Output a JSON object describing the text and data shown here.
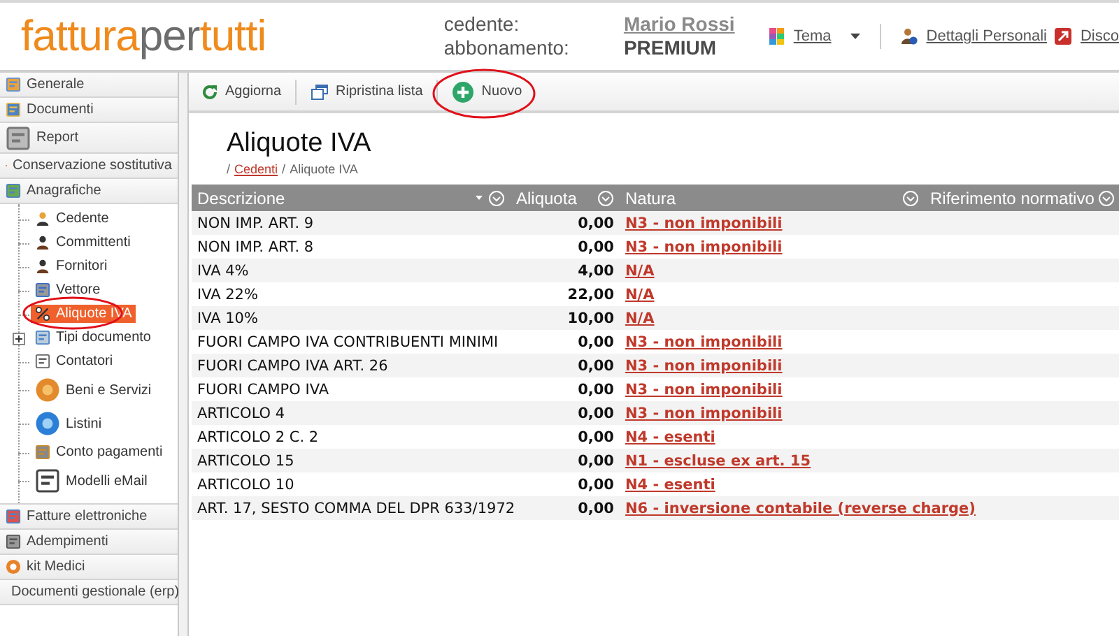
{
  "header": {
    "logo": [
      {
        "text": "fattura",
        "kind": "accent"
      },
      {
        "text": "per",
        "kind": "plain"
      },
      {
        "text": "tutti",
        "kind": "accent"
      }
    ],
    "account": [
      {
        "label": "cedente:",
        "value": "Mario Rossi",
        "kind": "link"
      },
      {
        "label": "abbonamento:",
        "value": "PREMIUM",
        "kind": "plain"
      }
    ],
    "links": [
      {
        "label": "Tema",
        "kind": "theme"
      },
      {
        "label": "Dettagli Personali",
        "kind": "user"
      },
      {
        "label": "Disco",
        "kind": "logout"
      }
    ]
  },
  "sidebar": {
    "sections_before": [
      {
        "label": "Generale"
      },
      {
        "label": "Documenti"
      },
      {
        "label": "Report"
      },
      {
        "label": "Conservazione sostitutiva"
      }
    ],
    "open_section": {
      "label": "Anagrafiche",
      "items": [
        {
          "label": "Cedente",
          "selected": false,
          "circled": false
        },
        {
          "label": "Committenti",
          "selected": false,
          "circled": false
        },
        {
          "label": "Fornitori",
          "selected": false,
          "circled": false
        },
        {
          "label": "Vettore",
          "selected": false,
          "circled": false
        },
        {
          "label": "Aliquote IVA",
          "selected": true,
          "circled": true
        },
        {
          "label": "Tipi documento",
          "selected": false,
          "circled": false,
          "expanded": false
        },
        {
          "label": "Contatori",
          "selected": false,
          "circled": false
        },
        {
          "label": "Beni e Servizi",
          "selected": false,
          "circled": false
        },
        {
          "label": "Listini",
          "selected": false,
          "circled": false
        },
        {
          "label": "Conto pagamenti",
          "selected": false,
          "circled": false
        },
        {
          "label": "Modelli eMail",
          "selected": false,
          "circled": false
        }
      ]
    },
    "sections_after": [
      {
        "label": "Fatture elettroniche"
      },
      {
        "label": "Adempimenti"
      },
      {
        "label": "kit Medici"
      },
      {
        "label": "Documenti gestionale (erp)"
      }
    ]
  },
  "toolbar": [
    {
      "label": "Aggiorna",
      "circled": false
    },
    {
      "label": "Ripristina lista",
      "circled": false
    },
    {
      "label": "Nuovo",
      "circled": true
    }
  ],
  "page": {
    "title": "Aliquote IVA",
    "breadcrumb": [
      {
        "text": "/",
        "kind": "separator"
      },
      {
        "text": "Cedenti",
        "kind": "link"
      },
      {
        "text": "/",
        "kind": "separator"
      },
      {
        "text": "Aliquote IVA",
        "kind": "current"
      }
    ]
  },
  "table": {
    "columns": [
      {
        "label": "Descrizione",
        "sorted": true
      },
      {
        "label": "Aliquota",
        "sorted": false
      },
      {
        "label": "Natura",
        "sorted": false
      },
      {
        "label": "Riferimento normativo",
        "sorted": false
      }
    ],
    "rows": [
      {
        "descrizione": "NON IMP. ART. 9",
        "aliquota": "0,00",
        "natura": "N3 - non imponibili"
      },
      {
        "descrizione": "NON IMP. ART. 8",
        "aliquota": "0,00",
        "natura": "N3 - non imponibili"
      },
      {
        "descrizione": "IVA 4%",
        "aliquota": "4,00",
        "natura": "N/A"
      },
      {
        "descrizione": "IVA 22%",
        "aliquota": "22,00",
        "natura": "N/A"
      },
      {
        "descrizione": "IVA 10%",
        "aliquota": "10,00",
        "natura": "N/A"
      },
      {
        "descrizione": "FUORI CAMPO IVA CONTRIBUENTI MINIMI",
        "aliquota": "0,00",
        "natura": "N3 - non imponibili"
      },
      {
        "descrizione": "FUORI CAMPO IVA ART. 26",
        "aliquota": "0,00",
        "natura": "N3 - non imponibili"
      },
      {
        "descrizione": "FUORI CAMPO IVA",
        "aliquota": "0,00",
        "natura": "N3 - non imponibili"
      },
      {
        "descrizione": "ARTICOLO 4",
        "aliquota": "0,00",
        "natura": "N3 - non imponibili"
      },
      {
        "descrizione": "ARTICOLO 2 C. 2",
        "aliquota": "0,00",
        "natura": "N4 - esenti"
      },
      {
        "descrizione": "ARTICOLO 15",
        "aliquota": "0,00",
        "natura": "N1 - escluse ex art. 15"
      },
      {
        "descrizione": "ARTICOLO 10",
        "aliquota": "0,00",
        "natura": "N4 - esenti"
      },
      {
        "descrizione": "ART. 17, SESTO COMMA DEL DPR 633/1972",
        "aliquota": "0,00",
        "natura": "N6 - inversione contabile (reverse charge)"
      }
    ]
  }
}
